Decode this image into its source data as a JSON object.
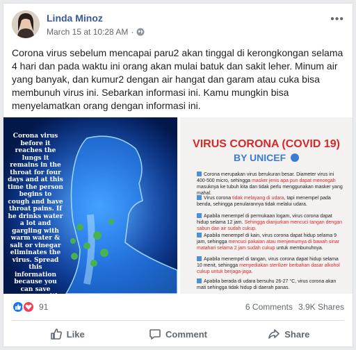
{
  "post": {
    "author": "Linda Minoz",
    "timestamp": "March 15 at 10:28 AM",
    "separator": "·",
    "privacy_icon": "globe-icon",
    "more_icon": "more-dots-icon",
    "more_glyph": "•••",
    "text": "Corona virus sebelum mencapai paru2 akan tinggal di kerongkongan selama 4 hari dan pada waktu ini orang akan mulai batuk dan sakit leher. Minum air yang banyak, dan kumur2 dengan air hangat dan garam atau cuka bisa membunuh virus ini. Sebarkan informasi ini. Kamu mungkin bisa menyelamatkan orang dengan informasi ini."
  },
  "media": {
    "left_caption": "Corona virus before it reaches the lungs it remains in the throat for four days and at this time the person begins to cough and have throat pains. If he drinks water a lot and gargling with warm water & salt or vinegar eliminates the virus. Spread this information because you can save someone with this information",
    "right_title": "VIRUS CORONA (COVID 19)",
    "right_subtitle": "BY UNICEF",
    "right_items": [
      {
        "text": "Corona merupakan virus berukuran besar. Diameter virus ini 400-500 micro, sehingga ",
        "highlight": "masker jenis apa pun dapat mencegah",
        "rest": " masuknya ke tubuh kita dan tidak perlu menggunakan masker yang mahal."
      },
      {
        "text": "Virus corona ",
        "highlight": "tidak melayang di udara",
        "rest": ", tapi menempel pada benda, sehingga penularannya tidak melalui udara."
      },
      {
        "text": "Apabila menempel di permukaan logam, virus corona dapat hidup selama 12 jam. ",
        "highlight": "Sehingga dianjurkan mencuci tangan dengan sabun dan air sudah cukup.",
        "rest": ""
      },
      {
        "text": "Apabila menempel di kain, virus corona dapat hidup selama 9 jam, sehingga ",
        "highlight": "mencuci pakaian atau menjemurnya di bawah sinar matahari selama 2 jam sudah cukup",
        "rest": " untuk membunuhnya."
      },
      {
        "text": "Apabila menempel di tangan, virus corona dapat hidup selama 10 menit, sehingga ",
        "highlight": "menyediakan sterilizer berbahan dasar alkohol cukup untuk berjaga-jaga.",
        "rest": ""
      },
      {
        "text": "Apabila berada di udara bersuhu 26-27 °C, virus corona akan mati sehingga tidak hidup di daerah panas.",
        "highlight": "",
        "rest": ""
      }
    ]
  },
  "stats": {
    "reaction_count": "91",
    "comments": "6 Comments",
    "shares": "3.9K Shares"
  },
  "actions": {
    "like": "Like",
    "comment": "Comment",
    "share": "Share"
  },
  "colors": {
    "author": "#385898",
    "like_blue": "#1877f2",
    "love_red": "#f33e58",
    "muted": "#606770"
  }
}
